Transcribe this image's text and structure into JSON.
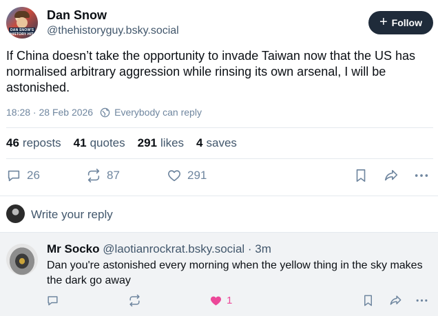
{
  "post": {
    "author_name": "Dan Snow",
    "author_handle": "@thehistoryguy.bsky.social",
    "avatar_caption": "DAN SNOW'S HISTORY HIT",
    "follow_label": "Follow",
    "text": "If China doesn’t take the opportunity to invade Taiwan now that the US has normalised arbitrary aggression while rinsing its own arsenal, I will be astonished.",
    "timestamp": "18:28 · 28 Feb 2026",
    "reply_setting": "Everybody can reply",
    "stats": {
      "reposts_count": "46",
      "reposts_label": "reposts",
      "quotes_count": "41",
      "quotes_label": "quotes",
      "likes_count": "291",
      "likes_label": "likes",
      "saves_count": "4",
      "saves_label": "saves"
    },
    "actions": {
      "replies": "26",
      "reposts": "87",
      "likes": "291"
    }
  },
  "reply_box": {
    "placeholder": "Write your reply"
  },
  "comment": {
    "author_name": "Mr Socko",
    "author_handle": "@laotianrockrat.bsky.social",
    "time": "· 3m",
    "text": "Dan you're astonished every morning when the yellow thing in the sky makes the dark go away",
    "likes": "1",
    "like_color": "#ec4899"
  },
  "colors": {
    "follow_bg": "#1f2b3a",
    "muted": "#6f869f",
    "comment_bg": "#f1f3f5"
  }
}
